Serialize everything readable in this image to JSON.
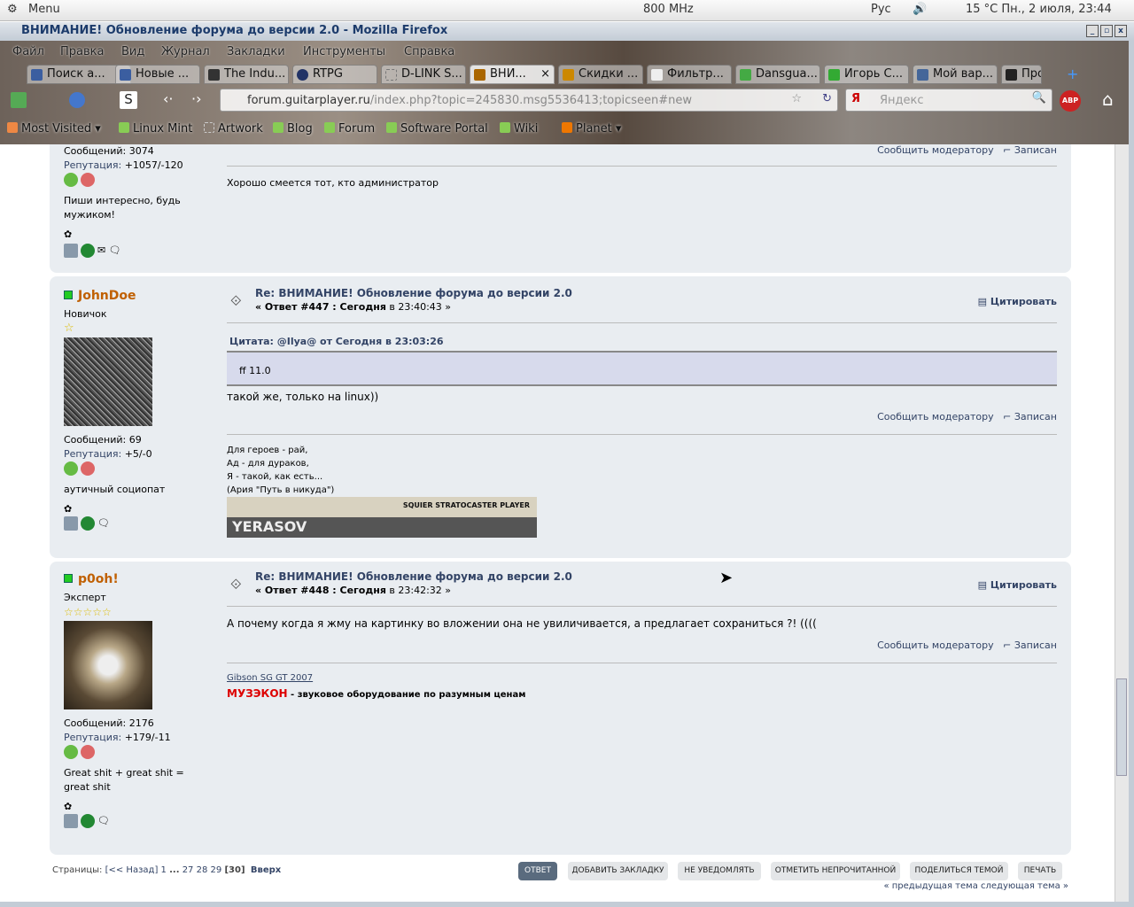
{
  "panel": {
    "menu": "Menu",
    "cpu": "800 MHz",
    "lang": "Рус",
    "weather_clock": "15 °C Пн., 2 июля, 23:44"
  },
  "window": {
    "title": "ВНИМАНИЕ! Обновление форума до версии 2.0 - Mozilla Firefox"
  },
  "menubar": [
    "Файл",
    "Правка",
    "Вид",
    "Журнал",
    "Закладки",
    "Инструменты",
    "Справка"
  ],
  "tabs": [
    "Поиск а...",
    "Новые ...",
    "The Indu...",
    "RTPG",
    "D-LINK S...",
    "ВНИ...",
    "Скидки ...",
    "Фильтр...",
    "Dansgua...",
    "Игорь С...",
    "Мой вар...",
    "Про"
  ],
  "url": {
    "host": "forum.guitarplayer.ru",
    "path": "/index.php?topic=245830.msg5536413;topicseen#new"
  },
  "search_placeholder": "Яндекс",
  "bookmarks": [
    "Most Visited",
    "Linux Mint",
    "Artwork",
    "Blog",
    "Forum",
    "Software Portal",
    "Wiki",
    "Planet"
  ],
  "posts": [
    {
      "posts_count": "Сообщений: 3074",
      "rep_label": "Репутация:",
      "rep": "+1057/-120",
      "status": "Пиши интересно, будь мужиком!",
      "report": "Сообщить модератору",
      "logged": "Записан",
      "signature": "Хорошо смеется тот, кто администратор"
    },
    {
      "user": "JohnDoe",
      "rank": "Новичок",
      "posts_count": "Сообщений: 69",
      "rep_label": "Репутация:",
      "rep": "+5/-0",
      "status": "аутичный социопат",
      "subject": "Re: ВНИМАНИЕ! Обновление форума до версии 2.0",
      "reply": "« Ответ #447 : Сегодня",
      "time": "в 23:40:43 »",
      "quote_btn": "Цитировать",
      "quote_header": "Цитата: @Ilya@ от Сегодня в 23:03:26",
      "quote_text": "ff 11.0",
      "text": "такой же, только на linux))",
      "report": "Сообщить модератору",
      "logged": "Записан",
      "signature": [
        "Для героев - рай,",
        "Ад - для дураков,",
        "Я - такой, как есть...",
        "(Ария \"Путь в никуда\")"
      ],
      "banner_top": "SQUIER STRATOCASTER PLAYER",
      "banner_bottom": "YERASOV"
    },
    {
      "user": "p0oh!",
      "rank": "Эксперт",
      "posts_count": "Сообщений: 2176",
      "rep_label": "Репутация:",
      "rep": "+179/-11",
      "status": "Great shit + great shit = great shit",
      "subject": "Re: ВНИМАНИЕ! Обновление форума до версии 2.0",
      "reply": "« Ответ #448 : Сегодня",
      "time": "в 23:42:32 »",
      "quote_btn": "Цитировать",
      "text": "А почему когда я жму на картинку во вложении она не увиличивается, а предлагает сохраниться ?! ((((",
      "report": "Сообщить модератору",
      "logged": "Записан",
      "sig_link": "Gibson SG GT 2007",
      "sig_brand": "МУЗЭКОН",
      "sig_rest": " - звуковое оборудование по разумным ценам"
    }
  ],
  "pagination": {
    "label": "Страницы:",
    "prev": "[<< Назад]",
    "p1": "1",
    "dots": "...",
    "p27": "27",
    "p28": "28",
    "p29": "29",
    "current": "[30]",
    "top": "Вверх"
  },
  "buttons": [
    "ОТВЕТ",
    "ДОБАВИТЬ ЗАКЛАДКУ",
    "НЕ УВЕДОМЛЯТЬ",
    "ОТМЕТИТЬ НЕПРОЧИТАННОЙ",
    "ПОДЕЛИТЬСЯ ТЕМОЙ",
    "ПЕЧАТЬ"
  ],
  "topic_nav": "« предыдущая тема следующая тема »"
}
